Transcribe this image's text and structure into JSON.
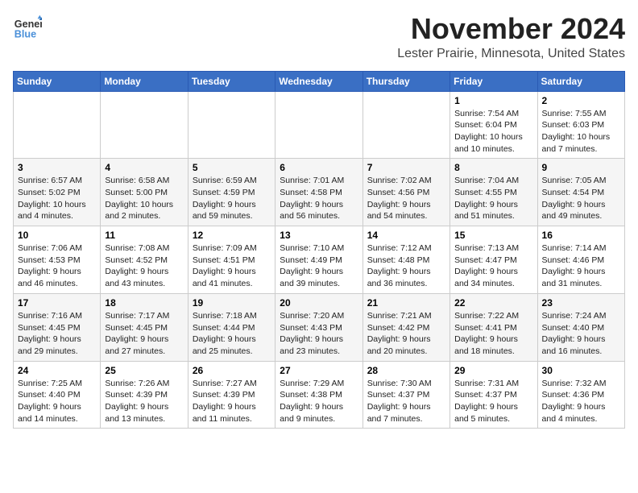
{
  "logo": {
    "line1": "General",
    "line2": "Blue"
  },
  "title": "November 2024",
  "location": "Lester Prairie, Minnesota, United States",
  "days_of_week": [
    "Sunday",
    "Monday",
    "Tuesday",
    "Wednesday",
    "Thursday",
    "Friday",
    "Saturday"
  ],
  "weeks": [
    [
      {
        "day": "",
        "info": ""
      },
      {
        "day": "",
        "info": ""
      },
      {
        "day": "",
        "info": ""
      },
      {
        "day": "",
        "info": ""
      },
      {
        "day": "",
        "info": ""
      },
      {
        "day": "1",
        "info": "Sunrise: 7:54 AM\nSunset: 6:04 PM\nDaylight: 10 hours\nand 10 minutes."
      },
      {
        "day": "2",
        "info": "Sunrise: 7:55 AM\nSunset: 6:03 PM\nDaylight: 10 hours\nand 7 minutes."
      }
    ],
    [
      {
        "day": "3",
        "info": "Sunrise: 6:57 AM\nSunset: 5:02 PM\nDaylight: 10 hours\nand 4 minutes."
      },
      {
        "day": "4",
        "info": "Sunrise: 6:58 AM\nSunset: 5:00 PM\nDaylight: 10 hours\nand 2 minutes."
      },
      {
        "day": "5",
        "info": "Sunrise: 6:59 AM\nSunset: 4:59 PM\nDaylight: 9 hours\nand 59 minutes."
      },
      {
        "day": "6",
        "info": "Sunrise: 7:01 AM\nSunset: 4:58 PM\nDaylight: 9 hours\nand 56 minutes."
      },
      {
        "day": "7",
        "info": "Sunrise: 7:02 AM\nSunset: 4:56 PM\nDaylight: 9 hours\nand 54 minutes."
      },
      {
        "day": "8",
        "info": "Sunrise: 7:04 AM\nSunset: 4:55 PM\nDaylight: 9 hours\nand 51 minutes."
      },
      {
        "day": "9",
        "info": "Sunrise: 7:05 AM\nSunset: 4:54 PM\nDaylight: 9 hours\nand 49 minutes."
      }
    ],
    [
      {
        "day": "10",
        "info": "Sunrise: 7:06 AM\nSunset: 4:53 PM\nDaylight: 9 hours\nand 46 minutes."
      },
      {
        "day": "11",
        "info": "Sunrise: 7:08 AM\nSunset: 4:52 PM\nDaylight: 9 hours\nand 43 minutes."
      },
      {
        "day": "12",
        "info": "Sunrise: 7:09 AM\nSunset: 4:51 PM\nDaylight: 9 hours\nand 41 minutes."
      },
      {
        "day": "13",
        "info": "Sunrise: 7:10 AM\nSunset: 4:49 PM\nDaylight: 9 hours\nand 39 minutes."
      },
      {
        "day": "14",
        "info": "Sunrise: 7:12 AM\nSunset: 4:48 PM\nDaylight: 9 hours\nand 36 minutes."
      },
      {
        "day": "15",
        "info": "Sunrise: 7:13 AM\nSunset: 4:47 PM\nDaylight: 9 hours\nand 34 minutes."
      },
      {
        "day": "16",
        "info": "Sunrise: 7:14 AM\nSunset: 4:46 PM\nDaylight: 9 hours\nand 31 minutes."
      }
    ],
    [
      {
        "day": "17",
        "info": "Sunrise: 7:16 AM\nSunset: 4:45 PM\nDaylight: 9 hours\nand 29 minutes."
      },
      {
        "day": "18",
        "info": "Sunrise: 7:17 AM\nSunset: 4:45 PM\nDaylight: 9 hours\nand 27 minutes."
      },
      {
        "day": "19",
        "info": "Sunrise: 7:18 AM\nSunset: 4:44 PM\nDaylight: 9 hours\nand 25 minutes."
      },
      {
        "day": "20",
        "info": "Sunrise: 7:20 AM\nSunset: 4:43 PM\nDaylight: 9 hours\nand 23 minutes."
      },
      {
        "day": "21",
        "info": "Sunrise: 7:21 AM\nSunset: 4:42 PM\nDaylight: 9 hours\nand 20 minutes."
      },
      {
        "day": "22",
        "info": "Sunrise: 7:22 AM\nSunset: 4:41 PM\nDaylight: 9 hours\nand 18 minutes."
      },
      {
        "day": "23",
        "info": "Sunrise: 7:24 AM\nSunset: 4:40 PM\nDaylight: 9 hours\nand 16 minutes."
      }
    ],
    [
      {
        "day": "24",
        "info": "Sunrise: 7:25 AM\nSunset: 4:40 PM\nDaylight: 9 hours\nand 14 minutes."
      },
      {
        "day": "25",
        "info": "Sunrise: 7:26 AM\nSunset: 4:39 PM\nDaylight: 9 hours\nand 13 minutes."
      },
      {
        "day": "26",
        "info": "Sunrise: 7:27 AM\nSunset: 4:39 PM\nDaylight: 9 hours\nand 11 minutes."
      },
      {
        "day": "27",
        "info": "Sunrise: 7:29 AM\nSunset: 4:38 PM\nDaylight: 9 hours\nand 9 minutes."
      },
      {
        "day": "28",
        "info": "Sunrise: 7:30 AM\nSunset: 4:37 PM\nDaylight: 9 hours\nand 7 minutes."
      },
      {
        "day": "29",
        "info": "Sunrise: 7:31 AM\nSunset: 4:37 PM\nDaylight: 9 hours\nand 5 minutes."
      },
      {
        "day": "30",
        "info": "Sunrise: 7:32 AM\nSunset: 4:36 PM\nDaylight: 9 hours\nand 4 minutes."
      }
    ]
  ]
}
